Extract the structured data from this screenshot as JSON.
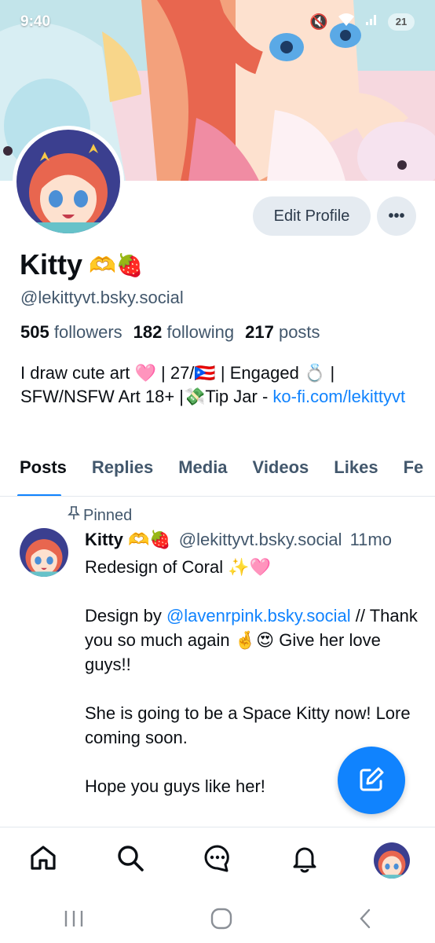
{
  "status_bar": {
    "time": "9:40",
    "battery": "21"
  },
  "profile": {
    "display_name": "Kitty",
    "name_emoji": "🫶🍓",
    "handle": "@lekittyvt.bsky.social",
    "followers_count": "505",
    "followers_label": "followers",
    "following_count": "182",
    "following_label": "following",
    "posts_count": "217",
    "posts_label": "posts",
    "bio_text": "I draw cute art 🩷 | 27/🇵🇷 | Engaged 💍 | SFW/NSFW Art 18+ |💸Tip Jar - ",
    "bio_link": "ko-fi.com/lekittyvt"
  },
  "actions": {
    "edit_profile": "Edit Profile",
    "more": "•••"
  },
  "tabs": [
    {
      "label": "Posts",
      "active": true
    },
    {
      "label": "Replies",
      "active": false
    },
    {
      "label": "Media",
      "active": false
    },
    {
      "label": "Videos",
      "active": false
    },
    {
      "label": "Likes",
      "active": false
    },
    {
      "label": "Fe",
      "active": false
    }
  ],
  "post": {
    "pinned_label": "Pinned",
    "author_name": "Kitty 🫶🍓",
    "author_handle": "@lekittyvt.bsky.social",
    "time": "11mo",
    "line1": "Redesign of Coral ✨🩷",
    "line2_prefix": "Design by ",
    "line2_link": "@lavenrpink.bsky.social",
    "line2_suffix": " // Thank you so much again 🤞😍 Give her love guys!!",
    "line3": "She is going to be a Space Kitty now! Lore coming soon.",
    "line4": "Hope you guys like her!"
  },
  "colors": {
    "accent": "#1083fe",
    "muted_text": "#42576c",
    "button_bg": "#e5ebf1"
  },
  "icons": [
    "home-icon",
    "search-icon",
    "chat-icon",
    "bell-icon",
    "compose-icon",
    "pin-icon"
  ]
}
